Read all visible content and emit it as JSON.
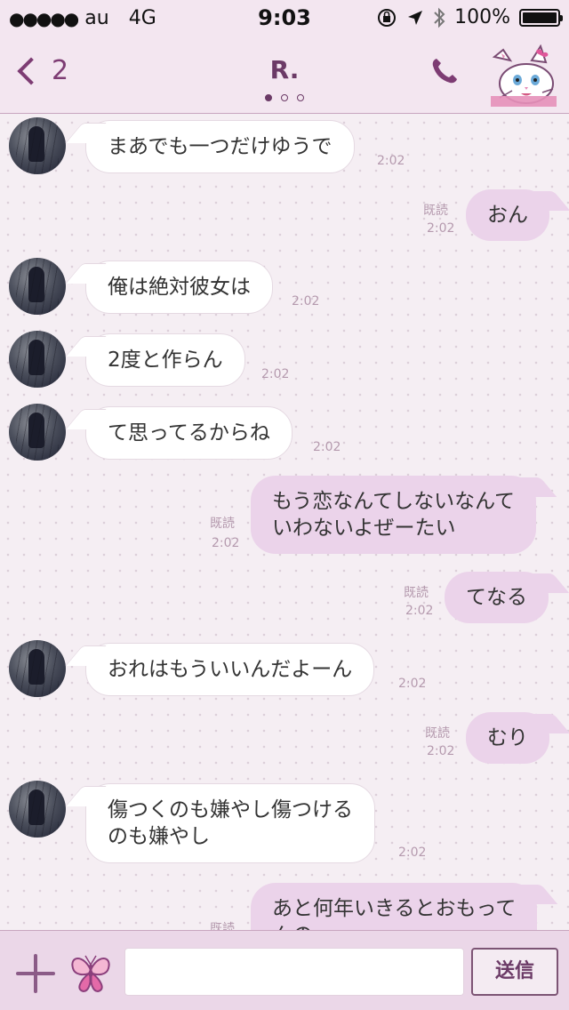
{
  "status_bar": {
    "carrier": "au",
    "network": "4G",
    "time": "9:03",
    "battery": "100%"
  },
  "header": {
    "back_count": "2",
    "title": "R."
  },
  "messages": [
    {
      "side": "in",
      "text": "まあでも一つだけゆうで",
      "time": "2:02"
    },
    {
      "side": "out",
      "text": "おん",
      "read": "既読",
      "time": "2:02"
    },
    {
      "side": "in",
      "text": "俺は絶対彼女は",
      "time": "2:02"
    },
    {
      "side": "in",
      "text": "2度と作らん",
      "time": "2:02"
    },
    {
      "side": "in",
      "text": "て思ってるからね",
      "time": "2:02"
    },
    {
      "side": "out",
      "lines": [
        "もう恋なんてしないなんて",
        "いわないよぜーたい"
      ],
      "read": "既読",
      "time": "2:02"
    },
    {
      "side": "out",
      "text": "てなる",
      "read": "既読",
      "time": "2:02"
    },
    {
      "side": "in",
      "text": "おれはもういいんだよーん",
      "time": "2:02"
    },
    {
      "side": "out",
      "text": "むり",
      "read": "既読",
      "time": "2:02"
    },
    {
      "side": "in",
      "lines": [
        "傷つくのも嫌やし傷つける",
        "のも嫌やし"
      ],
      "time": "2:02"
    },
    {
      "side": "out",
      "lines": [
        "あと何年いきるとおもって",
        "んの"
      ],
      "read": "既読"
    }
  ],
  "input": {
    "placeholder": "",
    "send_label": "送信"
  },
  "colors": {
    "accent": "#6b3a66",
    "outgoing_bubble": "#ebd3ea",
    "header_bg": "#f3e6f0"
  }
}
